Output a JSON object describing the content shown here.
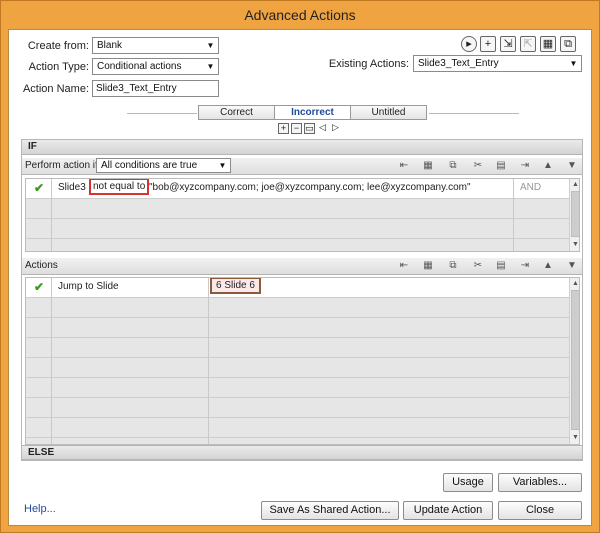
{
  "window": {
    "title": "Advanced Actions"
  },
  "form": {
    "create_from_label": "Create from:",
    "create_from_value": "Blank",
    "action_type_label": "Action Type:",
    "action_type_value": "Conditional actions",
    "action_name_label": "Action Name:",
    "action_name_value": "Slide3_Text_Entry",
    "existing_actions_label": "Existing Actions:",
    "existing_actions_value": "Slide3_Text_Entry"
  },
  "tabs": [
    {
      "label": "Correct",
      "active": false
    },
    {
      "label": "Incorrect",
      "active": true
    },
    {
      "label": "Untitled",
      "active": false
    }
  ],
  "if_section": {
    "header": "IF",
    "perform_label": "Perform action if:",
    "perform_value": "All conditions are true",
    "condition": {
      "variable": "Slide3",
      "operator": "not equal to",
      "value": "\"bob@xyzcompany.com; joe@xyzcompany.com; lee@xyzcompany.com\"",
      "join": "AND"
    }
  },
  "actions_section": {
    "header": "Actions",
    "action": {
      "command": "Jump to Slide",
      "target": "6 Slide 6"
    }
  },
  "else_section": {
    "header": "ELSE"
  },
  "buttons": {
    "usage": "Usage",
    "variables": "Variables...",
    "help": "Help...",
    "save_shared": "Save As Shared Action...",
    "update": "Update Action",
    "close": "Close"
  },
  "colors": {
    "title_bar": "#f0a341",
    "highlight_border": "#d9342b",
    "check": "#3a9a1f",
    "link": "#1f4ba0"
  }
}
